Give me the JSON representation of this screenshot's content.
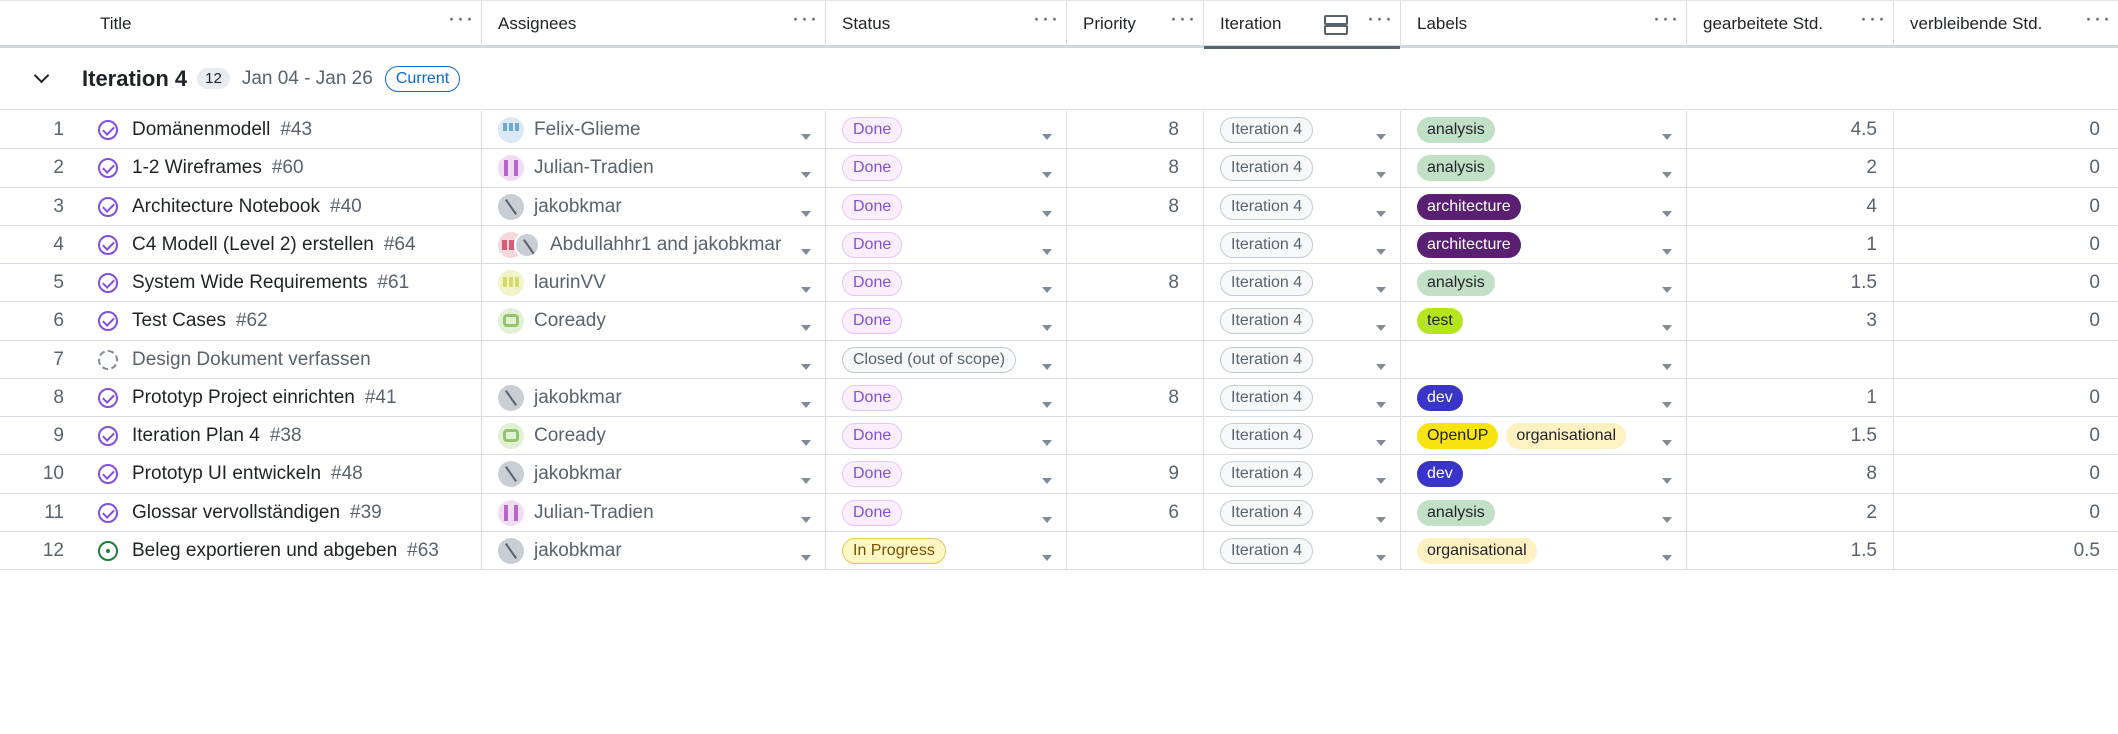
{
  "columns": {
    "title": "Title",
    "assignees": "Assignees",
    "status": "Status",
    "priority": "Priority",
    "iteration": "Iteration",
    "labels": "Labels",
    "worked": "gearbeitete Std.",
    "remaining": "verbleibende Std.",
    "more_icon": "···"
  },
  "group": {
    "title": "Iteration 4",
    "count": "12",
    "dates": "Jan 04 - Jan 26",
    "badge": "Current"
  },
  "label_colors": {
    "analysis": {
      "bg": "#c2e0c6",
      "fg": "#1f2328"
    },
    "architecture": {
      "bg": "#5a1e73",
      "fg": "#ffffff"
    },
    "test": {
      "bg": "#b5e61d",
      "fg": "#1f2328"
    },
    "dev": {
      "bg": "#3a34c9",
      "fg": "#ffffff"
    },
    "OpenUP": {
      "bg": "#f7e30f",
      "fg": "#1f2328"
    },
    "organisational": {
      "bg": "#fff1c2",
      "fg": "#1f2328"
    }
  },
  "rows": [
    {
      "num": "1",
      "title": "Domänenmodell",
      "issue": "#43",
      "state": "done",
      "assignee": "Felix-Glieme",
      "avatar": "blue",
      "status": "Done",
      "status_kind": "done",
      "priority": "8",
      "iteration": "Iteration 4",
      "labels": [
        "analysis"
      ],
      "worked": "4.5",
      "remaining": "0"
    },
    {
      "num": "2",
      "title": "1-2 Wireframes",
      "issue": "#60",
      "state": "done",
      "assignee": "Julian-Tradien",
      "avatar": "purple",
      "status": "Done",
      "status_kind": "done",
      "priority": "8",
      "iteration": "Iteration 4",
      "labels": [
        "analysis"
      ],
      "worked": "2",
      "remaining": "0"
    },
    {
      "num": "3",
      "title": "Architecture Notebook",
      "issue": "#40",
      "state": "done",
      "assignee": "jakobkmar",
      "avatar": "gray",
      "status": "Done",
      "status_kind": "done",
      "priority": "8",
      "iteration": "Iteration 4",
      "labels": [
        "architecture"
      ],
      "worked": "4",
      "remaining": "0"
    },
    {
      "num": "4",
      "title": "C4 Modell (Level 2) erstellen",
      "issue": "#64",
      "state": "done",
      "assignee": "Abdullahhr1 and jakobkmar",
      "avatar": "pair",
      "status": "Done",
      "status_kind": "done",
      "priority": "",
      "iteration": "Iteration 4",
      "labels": [
        "architecture"
      ],
      "worked": "1",
      "remaining": "0"
    },
    {
      "num": "5",
      "title": "System Wide Requirements",
      "issue": "#61",
      "state": "done",
      "assignee": "laurinVV",
      "avatar": "yellow",
      "status": "Done",
      "status_kind": "done",
      "priority": "8",
      "iteration": "Iteration 4",
      "labels": [
        "analysis"
      ],
      "worked": "1.5",
      "remaining": "0"
    },
    {
      "num": "6",
      "title": "Test Cases",
      "issue": "#62",
      "state": "done",
      "assignee": "Coready",
      "avatar": "green",
      "status": "Done",
      "status_kind": "done",
      "priority": "",
      "iteration": "Iteration 4",
      "labels": [
        "test"
      ],
      "worked": "3",
      "remaining": "0"
    },
    {
      "num": "7",
      "title": "Design Dokument verfassen",
      "issue": "",
      "state": "draft",
      "assignee": "",
      "avatar": "",
      "status": "Closed (out of scope)",
      "status_kind": "closed",
      "priority": "",
      "iteration": "Iteration 4",
      "labels": [],
      "worked": "",
      "remaining": ""
    },
    {
      "num": "8",
      "title": "Prototyp Project einrichten",
      "issue": "#41",
      "state": "done",
      "assignee": "jakobkmar",
      "avatar": "gray",
      "status": "Done",
      "status_kind": "done",
      "priority": "8",
      "iteration": "Iteration 4",
      "labels": [
        "dev"
      ],
      "worked": "1",
      "remaining": "0"
    },
    {
      "num": "9",
      "title": "Iteration Plan 4",
      "issue": "#38",
      "state": "done",
      "assignee": "Coready",
      "avatar": "green",
      "status": "Done",
      "status_kind": "done",
      "priority": "",
      "iteration": "Iteration 4",
      "labels": [
        "OpenUP",
        "organisational"
      ],
      "worked": "1.5",
      "remaining": "0"
    },
    {
      "num": "10",
      "title": "Prototyp UI entwickeln",
      "issue": "#48",
      "state": "done",
      "assignee": "jakobkmar",
      "avatar": "gray",
      "status": "Done",
      "status_kind": "done",
      "priority": "9",
      "iteration": "Iteration 4",
      "labels": [
        "dev"
      ],
      "worked": "8",
      "remaining": "0"
    },
    {
      "num": "11",
      "title": "Glossar vervollständigen",
      "issue": "#39",
      "state": "done",
      "assignee": "Julian-Tradien",
      "avatar": "purple",
      "status": "Done",
      "status_kind": "done",
      "priority": "6",
      "iteration": "Iteration 4",
      "labels": [
        "analysis"
      ],
      "worked": "2",
      "remaining": "0"
    },
    {
      "num": "12",
      "title": "Beleg exportieren und abgeben",
      "issue": "#63",
      "state": "open",
      "assignee": "jakobkmar",
      "avatar": "gray",
      "status": "In Progress",
      "status_kind": "progress",
      "priority": "",
      "iteration": "Iteration 4",
      "labels": [
        "organisational"
      ],
      "worked": "1.5",
      "remaining": "0.5"
    }
  ]
}
